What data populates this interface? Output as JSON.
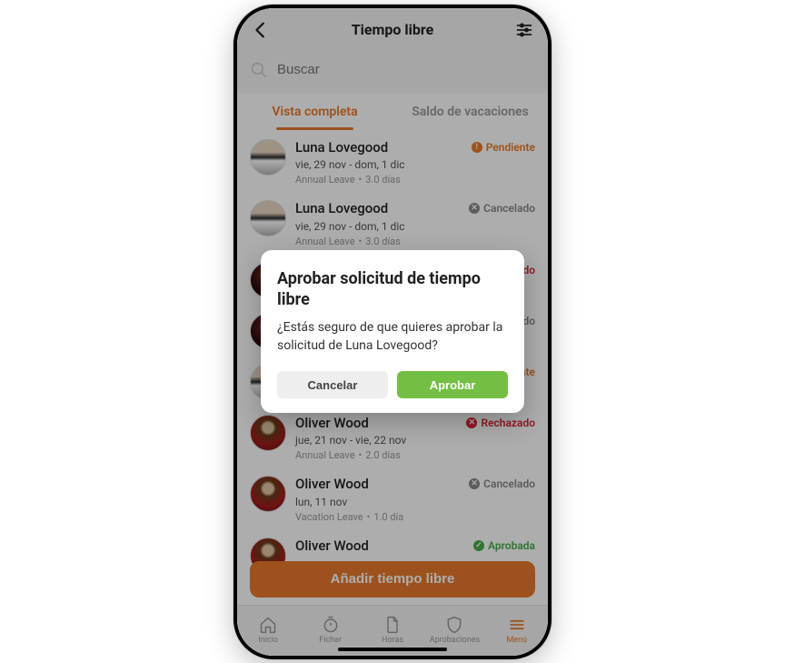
{
  "header": {
    "title": "Tiempo libre"
  },
  "search": {
    "placeholder": "Buscar"
  },
  "tabs": {
    "full": "Vista completa",
    "balance": "Saldo de vacaciones"
  },
  "statuses": {
    "pending": "Pendiente",
    "cancelled": "Cancelado",
    "rejected": "Rechazado",
    "approved": "Aprobada"
  },
  "rows": [
    {
      "name": "Luna Lovegood",
      "dates": "vie, 29 nov - dom, 1 dic",
      "type": "Annual Leave",
      "days": "3.0 días",
      "status": "pending",
      "avatar": "luna"
    },
    {
      "name": "Luna Lovegood",
      "dates": "vie, 29 nov - dom, 1 dic",
      "type": "Annual Leave",
      "days": "3.0 días",
      "status": "cancelled",
      "avatar": "luna"
    },
    {
      "name": "",
      "dates": "",
      "type": "",
      "days": "",
      "status": "rejected",
      "avatar": "dark"
    },
    {
      "name": "",
      "dates": "",
      "type": "",
      "days": "",
      "status": "cancelled",
      "avatar": "dark"
    },
    {
      "name": "",
      "dates": "",
      "type": "",
      "days": "",
      "status": "pending",
      "avatar": "luna"
    },
    {
      "name": "Oliver Wood",
      "dates": "jue, 21 nov - vie, 22 nov",
      "type": "Annual Leave",
      "days": "2.0 días",
      "status": "rejected",
      "avatar": "oliver"
    },
    {
      "name": "Oliver Wood",
      "dates": "lun, 11 nov",
      "type": "Vacation Leave",
      "days": "1.0 día",
      "status": "cancelled",
      "avatar": "oliver"
    },
    {
      "name": "Oliver Wood",
      "dates": "",
      "type": "",
      "days": "",
      "status": "approved",
      "avatar": "oliver"
    }
  ],
  "add_button": "Añadir tiempo libre",
  "nav": {
    "home": "Inicio",
    "clock": "Fichar",
    "hours": "Horas",
    "approvals": "Aprobaciones",
    "menu": "Menú"
  },
  "modal": {
    "title": "Aprobar solicitud de tiempo libre",
    "body": "¿Estás seguro de que quieres aprobar la solicitud de Luna Lovegood?",
    "cancel": "Cancelar",
    "approve": "Aprobar"
  }
}
